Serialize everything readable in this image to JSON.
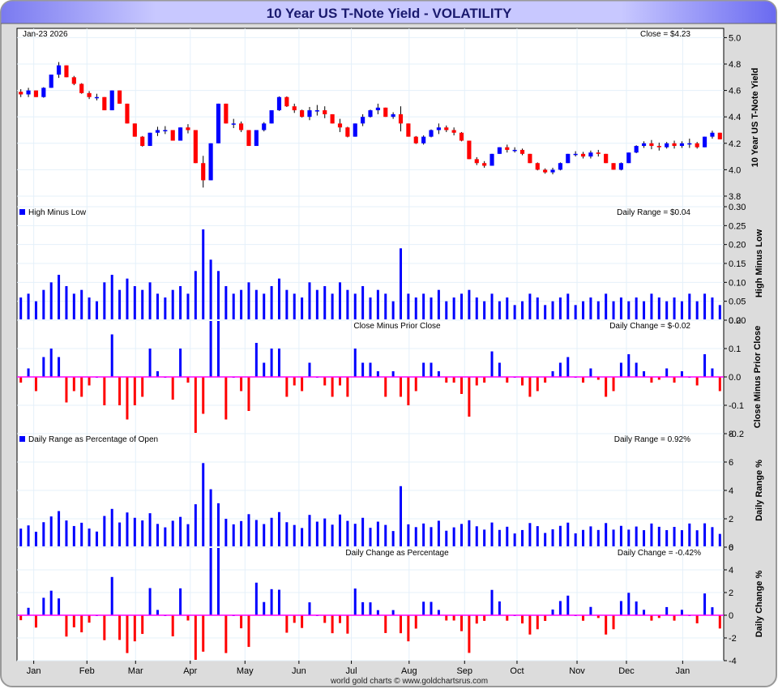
{
  "title": "10 Year US T-Note Yield - VOLATILITY",
  "date_label": "Jan-23  2026",
  "footer": "world gold charts © www.goldchartsrus.com",
  "colors": {
    "up": "#0000ff",
    "down": "#ff0000",
    "zero": "#ff00ff",
    "grid": "#e4f0fa",
    "title_bg": "#b8b8ff",
    "title_text": "#1a1a6e"
  },
  "chart_data": {
    "type": "bar",
    "x_month_ticks": [
      {
        "label": "Jan",
        "index": 2.2
      },
      {
        "label": "Feb",
        "index": 9.2
      },
      {
        "label": "Mar",
        "index": 15.6
      },
      {
        "label": "Apr",
        "index": 22.8
      },
      {
        "label": "May",
        "index": 30
      },
      {
        "label": "Jun",
        "index": 37.1
      },
      {
        "label": "Jul",
        "index": 44
      },
      {
        "label": "Aug",
        "index": 51.6
      },
      {
        "label": "Sep",
        "index": 58.9
      },
      {
        "label": "Oct",
        "index": 65.8
      },
      {
        "label": "Nov",
        "index": 73.7
      },
      {
        "label": "Dec",
        "index": 80.2
      },
      {
        "label": "Jan",
        "index": 87.6
      }
    ],
    "closes": [
      4.57,
      4.6,
      4.55,
      4.62,
      4.72,
      4.79,
      4.7,
      4.65,
      4.58,
      4.55,
      4.55,
      4.45,
      4.6,
      4.5,
      4.35,
      4.25,
      4.18,
      4.28,
      4.3,
      4.3,
      4.22,
      4.32,
      4.3,
      4.05,
      3.92,
      4.2,
      4.5,
      4.35,
      4.35,
      4.3,
      4.18,
      4.3,
      4.35,
      4.45,
      4.55,
      4.48,
      4.45,
      4.4,
      4.45,
      4.45,
      4.42,
      4.35,
      4.32,
      4.25,
      4.35,
      4.4,
      4.45,
      4.47,
      4.4,
      4.42,
      4.35,
      4.25,
      4.2,
      4.25,
      4.3,
      4.32,
      4.3,
      4.28,
      4.22,
      4.08,
      4.05,
      4.03,
      4.12,
      4.17,
      4.15,
      4.15,
      4.12,
      4.05,
      4.0,
      3.98,
      4.0,
      4.05,
      4.12,
      4.12,
      4.1,
      4.13,
      4.12,
      4.05,
      4.0,
      4.05,
      4.13,
      4.18,
      4.2,
      4.18,
      4.17,
      4.2,
      4.18,
      4.2,
      4.2,
      4.17,
      4.25,
      4.28,
      4.23
    ],
    "high_minus_low": [
      0.06,
      0.07,
      0.05,
      0.08,
      0.1,
      0.12,
      0.09,
      0.07,
      0.08,
      0.06,
      0.05,
      0.1,
      0.12,
      0.08,
      0.11,
      0.09,
      0.08,
      0.1,
      0.07,
      0.06,
      0.08,
      0.09,
      0.07,
      0.13,
      0.24,
      0.16,
      0.13,
      0.09,
      0.07,
      0.08,
      0.1,
      0.08,
      0.07,
      0.09,
      0.11,
      0.08,
      0.07,
      0.06,
      0.1,
      0.08,
      0.09,
      0.07,
      0.1,
      0.08,
      0.07,
      0.09,
      0.06,
      0.08,
      0.07,
      0.05,
      0.19,
      0.07,
      0.06,
      0.07,
      0.06,
      0.08,
      0.05,
      0.06,
      0.07,
      0.08,
      0.06,
      0.05,
      0.07,
      0.05,
      0.06,
      0.04,
      0.05,
      0.07,
      0.06,
      0.04,
      0.05,
      0.06,
      0.07,
      0.04,
      0.05,
      0.06,
      0.05,
      0.07,
      0.05,
      0.06,
      0.05,
      0.06,
      0.05,
      0.07,
      0.06,
      0.05,
      0.06,
      0.05,
      0.07,
      0.05,
      0.07,
      0.06,
      0.04
    ],
    "panels": [
      {
        "key": "price",
        "ylabel": "10 Year US T-Note Yield",
        "left_label": "",
        "center_label": "",
        "readout": "Close = $4.23",
        "ylim": [
          3.72,
          5.07
        ],
        "ticks": [
          "3.8",
          "4.0",
          "4.2",
          "4.4",
          "4.6",
          "4.8",
          "5.0"
        ]
      },
      {
        "key": "range",
        "ylabel": "High Minus Low",
        "left_label": "High Minus Low",
        "center_label": "",
        "readout": "Daily Range = $0.04",
        "ylim": [
          0,
          0.3
        ],
        "ticks": [
          "0.00",
          "0.05",
          "0.10",
          "0.15",
          "0.20",
          "0.25",
          "0.30"
        ]
      },
      {
        "key": "change",
        "ylabel": "Close Minus Prior Close",
        "left_label": "",
        "center_label": "Close Minus Prior Close",
        "readout": "Daily Change = $-0.02",
        "ylim": [
          -0.2,
          0.2
        ],
        "ticks": [
          "-0.2",
          "-0.1",
          "0.0",
          "0.1",
          "0.2"
        ]
      },
      {
        "key": "range_pct",
        "ylabel": "Daily Range %",
        "left_label": "Daily Range as Percentage of Open",
        "center_label": "",
        "readout": "Daily Range = 0.92%",
        "ylim": [
          0,
          8
        ],
        "ticks": [
          "0",
          "2",
          "4",
          "6",
          "8"
        ]
      },
      {
        "key": "change_pct",
        "ylabel": "Daily Change %",
        "left_label": "",
        "center_label": "Daily Change as Percentage",
        "readout": "Daily Change = -0.42%",
        "ylim": [
          -4,
          6
        ],
        "ticks": [
          "-4",
          "-2",
          "0",
          "2",
          "4",
          "6"
        ]
      }
    ]
  }
}
